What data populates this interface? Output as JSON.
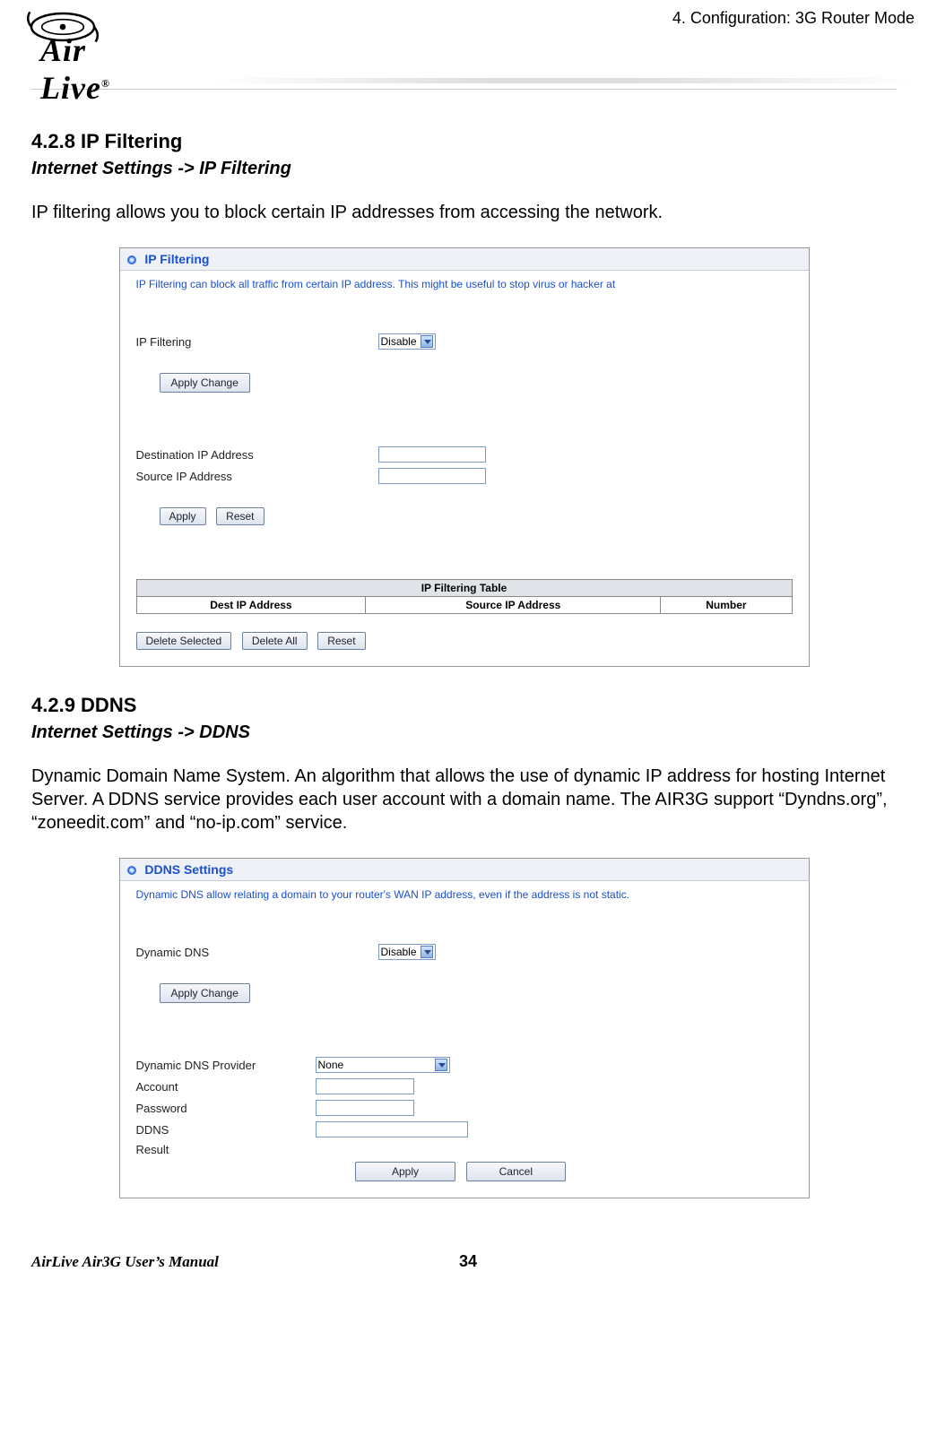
{
  "header": {
    "logo_text": "Air Live",
    "chapter": "4. Configuration: 3G Router Mode"
  },
  "sections": {
    "s1": {
      "heading": "4.2.8 IP Filtering",
      "path": "Internet Settings -> IP Filtering",
      "body": "IP filtering allows you to block certain IP addresses from accessing the network."
    },
    "s2": {
      "heading": "4.2.9 DDNS",
      "path": "Internet Settings -> DDNS",
      "body": "Dynamic Domain Name System. An algorithm that allows the use of dynamic IP address for hosting Internet Server.   A DDNS service provides each user account with a domain name. The AIR3G support “Dyndns.org”, “zoneedit.com” and “no-ip.com” service."
    }
  },
  "panel_ip": {
    "title": "IP Filtering",
    "hint": "IP Filtering can block all traffic from certain IP address. This might be useful to stop virus or hacker at",
    "label_filtering": "IP Filtering",
    "select_filtering": "Disable",
    "btn_apply_change": "Apply Change",
    "label_dest": "Destination IP Address",
    "label_src": "Source IP Address",
    "btn_apply": "Apply",
    "btn_reset": "Reset",
    "table_title": "IP Filtering Table",
    "col_dest": "Dest IP Address",
    "col_src": "Source IP Address",
    "col_num": "Number",
    "btn_delete_selected": "Delete Selected",
    "btn_delete_all": "Delete All",
    "btn_reset2": "Reset"
  },
  "panel_ddns": {
    "title": "DDNS Settings",
    "hint": "Dynamic DNS allow relating a domain to your router's WAN IP address, even if the address is not static.",
    "label_dns": "Dynamic DNS",
    "select_dns": "Disable",
    "btn_apply_change": "Apply Change",
    "label_provider": "Dynamic DNS Provider",
    "select_provider": "None",
    "label_account": "Account",
    "label_password": "Password",
    "label_ddns": "DDNS",
    "label_result": "Result",
    "btn_apply": "Apply",
    "btn_cancel": "Cancel"
  },
  "footer": {
    "left": "AirLive Air3G User’s Manual",
    "page": "34"
  }
}
